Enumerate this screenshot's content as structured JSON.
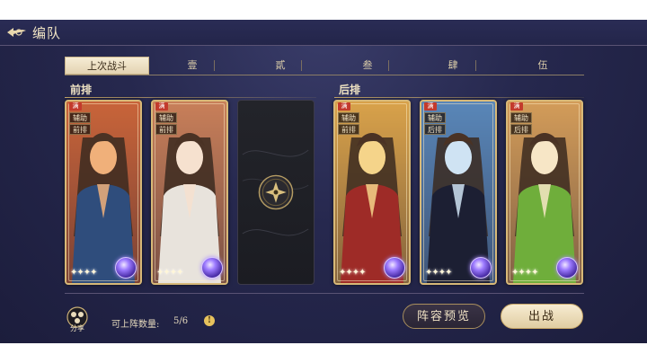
{
  "header": {
    "title": "编队",
    "back_icon": "back-arrow-icon"
  },
  "tabs": [
    {
      "label": "上次战斗",
      "active": true
    },
    {
      "label": "壹",
      "active": false
    },
    {
      "label": "貳",
      "active": false
    },
    {
      "label": "叁",
      "active": false
    },
    {
      "label": "肆",
      "active": false
    },
    {
      "label": "伍",
      "active": false
    }
  ],
  "rows": {
    "front_label": "前排",
    "back_label": "后排"
  },
  "cards": [
    {
      "badge": "满",
      "tags": [
        "辅助",
        "前排"
      ],
      "stars": "✦✦✦✦",
      "palette": [
        "#c9653a",
        "#f0b07a",
        "#2f4d7c"
      ]
    },
    {
      "badge": "满",
      "tags": [
        "辅助",
        "前排"
      ],
      "stars": "✦✦✦✦",
      "palette": [
        "#c87f5a",
        "#f6e1cf",
        "#e8e3dc"
      ]
    },
    {
      "badge": "满",
      "tags": [
        "辅助",
        "前排"
      ],
      "stars": "✦✦✦✦",
      "palette": [
        "#d9a24a",
        "#f5d48a",
        "#9e2b27"
      ]
    },
    {
      "badge": "满",
      "tags": [
        "辅助",
        "后排"
      ],
      "stars": "✦✦✦✦",
      "palette": [
        "#5a86b8",
        "#cfe3f3",
        "#1c1f33"
      ]
    },
    {
      "badge": "满",
      "tags": [
        "辅助",
        "后排"
      ],
      "stars": "✦✦✦✦",
      "palette": [
        "#d39c5a",
        "#f7e6c6",
        "#6fae3b"
      ]
    }
  ],
  "footer": {
    "share_label": "分享",
    "count_label": "可上阵数量:",
    "count_value": "5/6",
    "info_symbol": "!",
    "preview_button": "阵容预览",
    "fight_button": "出战"
  },
  "colors": {
    "accent_gold": "#d7b877",
    "background": "#26284e"
  }
}
